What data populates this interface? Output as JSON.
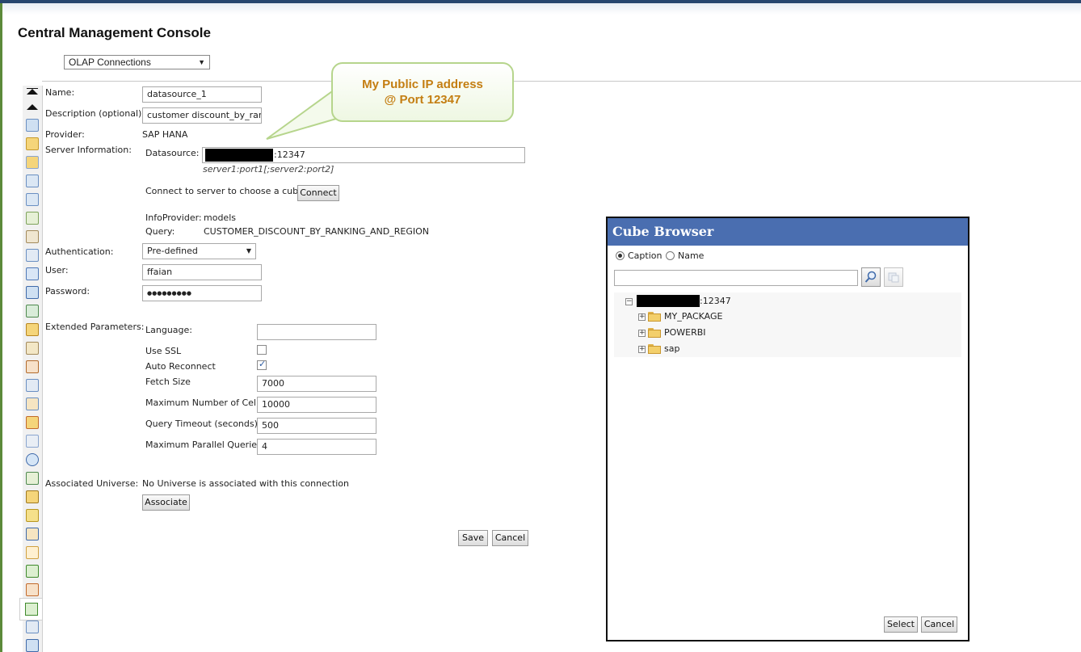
{
  "app": {
    "title": "Central Management Console"
  },
  "view_select": {
    "value": "OLAP Connections"
  },
  "callout": {
    "line1": "My Public IP address",
    "line2": "@ Port 12347"
  },
  "form": {
    "name_label": "Name:",
    "name_value": "datasource_1",
    "description_label": "Description (optional):",
    "description_value": "customer discount_by_rankin",
    "provider_label": "Provider:",
    "provider_value": "SAP HANA",
    "server_info_label": "Server Information:",
    "datasource_label": "Datasource:",
    "datasource_value": ":12347",
    "datasource_hint": "server1:port1[;server2:port2]",
    "connect_label": "Connect to server to choose a cube:",
    "connect_button": "Connect",
    "infoprovider_label": "InfoProvider:",
    "infoprovider_value": "models",
    "query_label": "Query:",
    "query_value": "CUSTOMER_DISCOUNT_BY_RANKING_AND_REGION",
    "authentication_label": "Authentication:",
    "authentication_value": "Pre-defined",
    "user_label": "User:",
    "user_value": "ffaian",
    "password_label": "Password:",
    "password_value": "●●●●●●●●●",
    "extended_label": "Extended Parameters:",
    "language_label": "Language:",
    "language_value": "",
    "use_ssl_label": "Use SSL",
    "use_ssl_checked": false,
    "auto_reconnect_label": "Auto Reconnect",
    "auto_reconnect_checked": true,
    "fetch_size_label": "Fetch Size",
    "fetch_size_value": "7000",
    "max_cells_label": "Maximum Number of Cells",
    "max_cells_value": "10000",
    "query_timeout_label": "Query Timeout (seconds)",
    "query_timeout_value": "500",
    "max_parallel_label": "Maximum Parallel Queries",
    "max_parallel_value": "4",
    "universe_label": "Associated Universe:",
    "universe_value": "No Universe is associated with this connection",
    "associate_button": "Associate",
    "save_button": "Save",
    "cancel_button": "Cancel"
  },
  "cube_browser": {
    "title": "Cube Browser",
    "radio_caption": "Caption",
    "radio_name": "Name",
    "selected_radio": "Caption",
    "search_value": "",
    "root_node": ":12347",
    "items": [
      {
        "label": "MY_PACKAGE"
      },
      {
        "label": "POWERBI"
      },
      {
        "label": "sap"
      }
    ],
    "select_button": "Select",
    "cancel_button": "Cancel"
  },
  "colors": {
    "cube_title_bg": "#4a6eb0",
    "callout_text": "#c47e12",
    "callout_border": "#b6d58c"
  }
}
